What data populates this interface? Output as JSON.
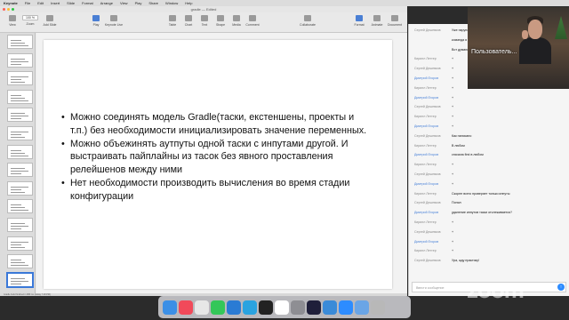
{
  "menubar": {
    "items": [
      "Keynote",
      "File",
      "Edit",
      "Insert",
      "Slide",
      "Format",
      "Arrange",
      "View",
      "Play",
      "Share",
      "Window",
      "Help"
    ]
  },
  "window": {
    "title": "gradle — Edited"
  },
  "toolbar": {
    "items": [
      {
        "label": "View",
        "icon": "view-icon"
      },
      {
        "label": "Zoom",
        "icon": "zoom-icon"
      },
      {
        "label": "Add Slide",
        "icon": "add-slide-icon"
      },
      {
        "label": "Play",
        "icon": "play-icon"
      },
      {
        "label": "Keynote Live",
        "icon": "keynote-live-icon"
      },
      {
        "label": "Table",
        "icon": "table-icon"
      },
      {
        "label": "Chart",
        "icon": "chart-icon"
      },
      {
        "label": "Text",
        "icon": "text-icon"
      },
      {
        "label": "Shape",
        "icon": "shape-icon"
      },
      {
        "label": "Media",
        "icon": "media-icon"
      },
      {
        "label": "Comment",
        "icon": "comment-icon"
      },
      {
        "label": "Collaborate",
        "icon": "collaborate-icon"
      },
      {
        "label": "Format",
        "icon": "format-icon"
      },
      {
        "label": "Animate",
        "icon": "animate-icon"
      },
      {
        "label": "Document",
        "icon": "document-icon"
      }
    ],
    "zoom_value": "100 %"
  },
  "slide": {
    "bullets": [
      "Можно соединять модель Gradle(таски, екстеншены, проекты и т.п.) без необходимости инициализировать значение переменных.",
      "Можно объежинять аутпуты одной таски с инпутами другой. И выстраивать пайплайны из тасок без явного проставления релейшенов между ними",
      "Нет необходимости производить вычисления во время стадии конфигурации"
    ]
  },
  "status": {
    "text": "Gradle build finished in 889 ms (today 7:18 PM)"
  },
  "video": {
    "caption": "Пользователь..."
  },
  "chat": {
    "messages": [
      {
        "name": "Сергей Дешевков",
        "text": "Уже парупохобие",
        "blue": false
      },
      {
        "name": "",
        "text": "команда я один разработчик",
        "blue": false
      },
      {
        "name": "",
        "text": "Вот думаю стоит ли пройти",
        "blue": false
      },
      {
        "name": "Кирилл Леттер",
        "text": "+",
        "blue": false
      },
      {
        "name": "Сергей Дешевков",
        "text": "+",
        "blue": false
      },
      {
        "name": "Дмитрий Егоров",
        "text": "+",
        "blue": true
      },
      {
        "name": "Кирилл Леттер",
        "text": "+",
        "blue": false
      },
      {
        "name": "Дмитрий Егоров",
        "text": "+",
        "blue": true
      },
      {
        "name": "Сергей Дешевков",
        "text": "+",
        "blue": false
      },
      {
        "name": "Кирилл Леттер",
        "text": "+",
        "blue": false
      },
      {
        "name": "Дмитрий Егоров",
        "text": "+",
        "blue": true
      },
      {
        "name": "Сергей Дешевков",
        "text": "Как написано",
        "blue": false
      },
      {
        "name": "Кирилл Леттер",
        "text": "В любом",
        "blue": false
      },
      {
        "name": "Дмитрий Егоров",
        "text": "сначала first в любом",
        "blue": true
      },
      {
        "name": "Кирилл Леттер",
        "text": "+",
        "blue": false
      },
      {
        "name": "Сергей Дешевков",
        "text": "+",
        "blue": false
      },
      {
        "name": "Дмитрий Егоров",
        "text": "+",
        "blue": true
      },
      {
        "name": "Кирилл Леттер",
        "text": "Скорее всего проверяет только инпуты",
        "blue": false
      },
      {
        "name": "Сергей Дешевков",
        "text": "Понял",
        "blue": false
      },
      {
        "name": "Дмитрий Егоров",
        "text": "удаление инпутов таски отслеживается?",
        "blue": true
      },
      {
        "name": "Кирилл Леттер",
        "text": "+",
        "blue": false
      },
      {
        "name": "Сергей Дешевков",
        "text": "+",
        "blue": false
      },
      {
        "name": "Дмитрий Егоров",
        "text": "+",
        "blue": true
      },
      {
        "name": "Кирилл Леттер",
        "text": "+",
        "blue": false
      },
      {
        "name": "Сергей Дешевков",
        "text": "Ура, жду практику!",
        "blue": false
      }
    ],
    "input_placeholder": "Ввести сообщение"
  },
  "zoom_watermark": "zoom",
  "dock": {
    "apps": [
      {
        "icon": "finder-icon",
        "color": "#3b8fe6"
      },
      {
        "icon": "music-icon",
        "color": "#f14a5a"
      },
      {
        "icon": "chrome-icon",
        "color": "#e7e7e7"
      },
      {
        "icon": "facetime-icon",
        "color": "#34c759"
      },
      {
        "icon": "vscode-icon",
        "color": "#2a7bd4"
      },
      {
        "icon": "telegram-icon",
        "color": "#2aa3e0"
      },
      {
        "icon": "terminal-icon",
        "color": "#222222"
      },
      {
        "icon": "slack-icon",
        "color": "#ffffff"
      },
      {
        "icon": "settings-icon",
        "color": "#8e8e93"
      },
      {
        "icon": "intellij-icon",
        "color": "#1f1f3a"
      },
      {
        "icon": "keynote-icon",
        "color": "#3a8bd8"
      },
      {
        "icon": "zoom-app-icon",
        "color": "#2d8cff"
      },
      {
        "icon": "finder-folder-icon",
        "color": "#6aa5e6"
      },
      {
        "icon": "trash-icon",
        "color": "#b8b8b8"
      }
    ]
  }
}
